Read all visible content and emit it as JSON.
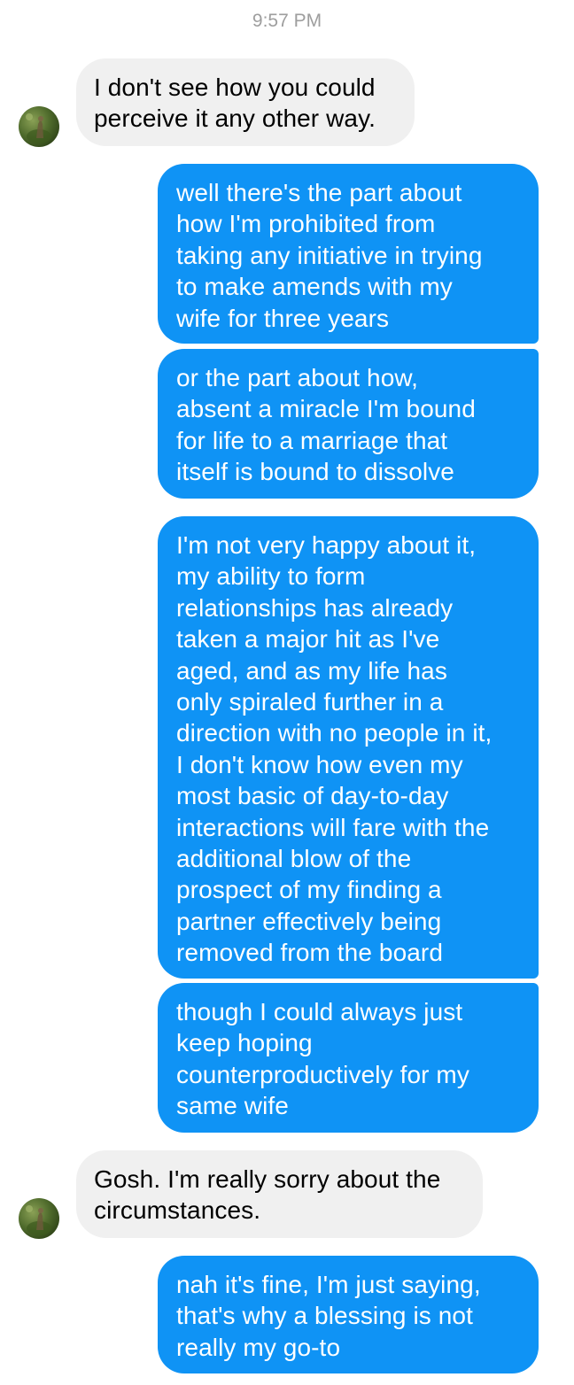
{
  "timestamp": "9:57 PM",
  "messages": [
    {
      "id": "m1",
      "sender": "them",
      "text": "I don't see how you could\nperceive it any other way."
    },
    {
      "id": "m2",
      "sender": "me",
      "text": "well there's the part about\nhow I'm prohibited from\ntaking any initiative in trying\nto make amends with my\nwife for three years"
    },
    {
      "id": "m3",
      "sender": "me",
      "text": "or the part about how,\nabsent a miracle I'm bound\nfor life to a marriage that\nitself is bound to dissolve"
    },
    {
      "id": "m4",
      "sender": "me",
      "text": "I'm not very happy about it,\nmy ability to form\nrelationships has already\ntaken a major hit as I've\naged, and as my life has\nonly spiraled further in a\ndirection with no people in it,\nI don't know how even my\nmost basic of day-to-day\ninteractions will fare with the\nadditional blow of the\nprospect of my finding a\npartner effectively being\nremoved from the board"
    },
    {
      "id": "m5",
      "sender": "me",
      "text": "though I could always just\nkeep hoping\ncounterproductively for my\nsame wife"
    },
    {
      "id": "m6",
      "sender": "them",
      "text": "Gosh. I'm really sorry about the\ncircumstances."
    },
    {
      "id": "m7",
      "sender": "me",
      "text": "nah it's fine, I'm just saying,\nthat's why a blessing is not\nreally my go-to"
    }
  ],
  "colors": {
    "outgoing_bubble": "#0f93f5",
    "incoming_bubble": "#f0f0f0",
    "timestamp_text": "#9e9e9e"
  },
  "icons": {
    "contact_avatar": "contact-avatar-photo"
  }
}
